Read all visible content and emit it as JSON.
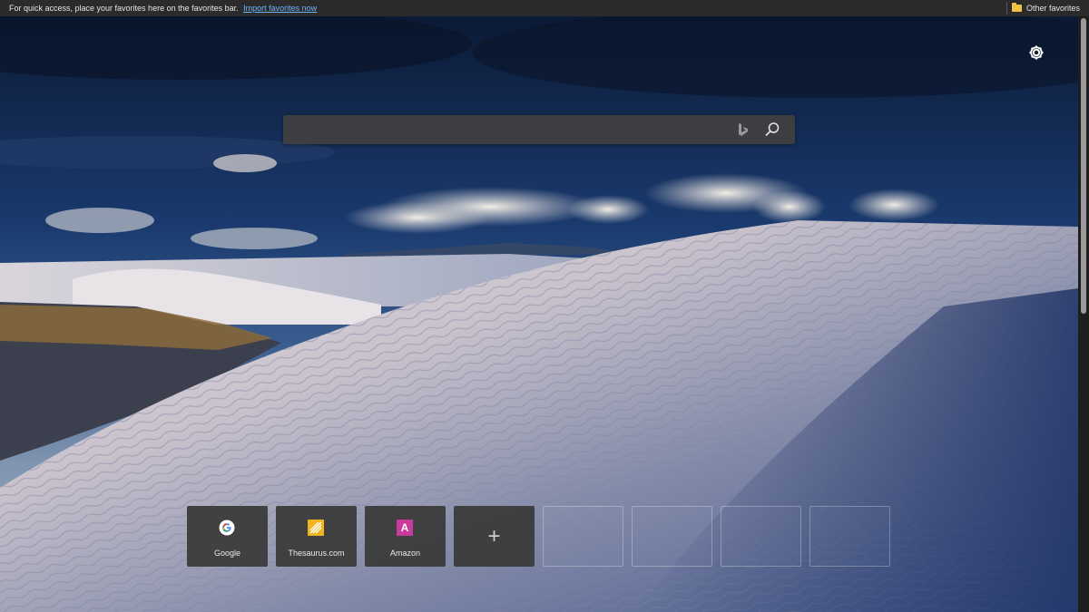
{
  "favorites_bar": {
    "message": "For quick access, place your favorites here on the favorites bar.",
    "import_link": "Import favorites now",
    "other_favorites": "Other favorites"
  },
  "settings": {
    "icon": "gear-icon"
  },
  "search": {
    "value": "",
    "placeholder": "",
    "bing_icon": "bing-logo-icon",
    "search_icon": "magnifier-icon"
  },
  "quick_links": {
    "tiles": [
      {
        "label": "Google",
        "icon": "google-icon"
      },
      {
        "label": "Thesaurus.com",
        "icon": "thesaurus-icon"
      },
      {
        "label": "Amazon",
        "icon": "amazon-icon",
        "icon_letter": "A"
      }
    ],
    "add_symbol": "+",
    "empty_slots": 4
  },
  "colors": {
    "favbar_bg": "#2b2b2b",
    "link": "#6cb4ff",
    "tile_bg": "#3a3a3a",
    "amazon": "#c93a9a",
    "thesaurus": "#f2b41b"
  }
}
